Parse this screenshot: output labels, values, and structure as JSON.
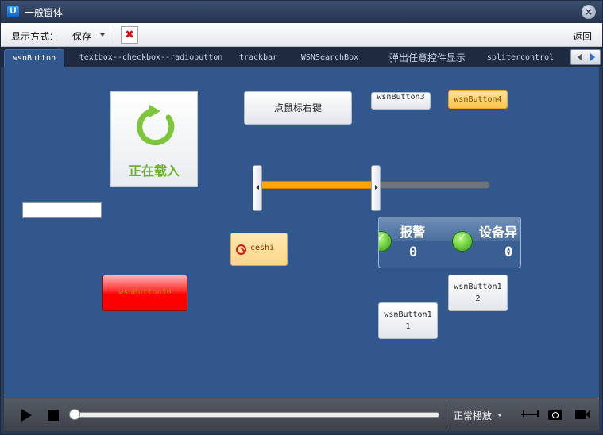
{
  "window": {
    "title": "一般窗体",
    "icon_letter": "U",
    "close_glyph": "×"
  },
  "toolbar": {
    "display_label": "显示方式：",
    "save_label": "保存",
    "close_glyph": "✖",
    "back_label": "返回"
  },
  "tabs": [
    {
      "label": "wsnButton",
      "active": true
    },
    {
      "label": "textbox--checkbox--radiobutton",
      "active": false
    },
    {
      "label": "trackbar",
      "active": false
    },
    {
      "label": "WSNSearchBox",
      "active": false
    },
    {
      "label": "弹出任意控件显示",
      "active": false
    },
    {
      "label": "splitercontrol",
      "active": false
    }
  ],
  "content": {
    "loader_text": "正在载入",
    "right_click_button": "点鼠标右键",
    "wsn_button3": "wsnButton3",
    "wsn_button4": "wsnButton4",
    "ceshi_button": "ceshi",
    "wsn_button10": "wsnButton10",
    "wsn_button12": "wsnButton12",
    "wsn_button11": "wsnButton11",
    "text_input_value": "",
    "alarm_panel": {
      "label1": "报警",
      "value1": "0",
      "label2": "设备异",
      "value2": "0"
    },
    "slider": {
      "value_fraction": 0.5
    }
  },
  "player": {
    "mode_label": "正常播放",
    "progress_fraction": 0,
    "icons": [
      "play-icon",
      "stop-icon",
      "fit-width-icon",
      "camera-icon",
      "video-icon"
    ]
  },
  "colors": {
    "content_bg": "#31578c",
    "accent_orange": "#ffa500",
    "alarm_green": "#2f9d12",
    "red_button": "#ff0000"
  }
}
